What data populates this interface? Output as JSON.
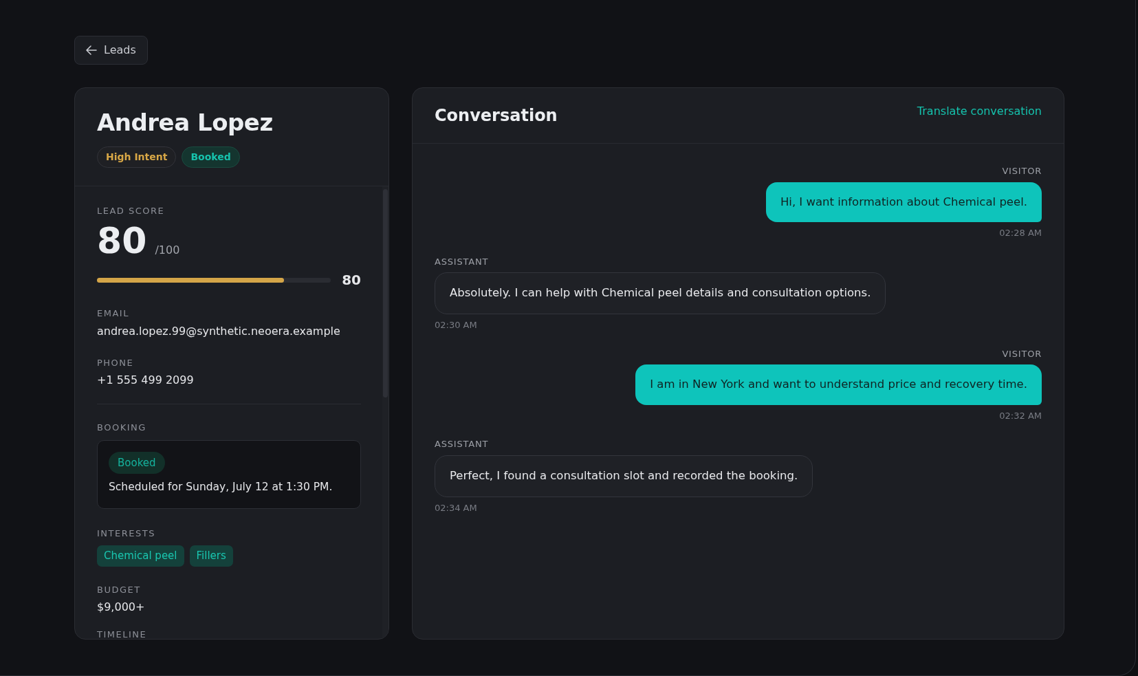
{
  "back_button": {
    "label": "Leads"
  },
  "lead": {
    "name": "Andrea Lopez",
    "badges": [
      {
        "label": "High Intent",
        "kind": "intent"
      },
      {
        "label": "Booked",
        "kind": "status"
      }
    ],
    "lead_score": {
      "label": "LEAD SCORE",
      "value": "80",
      "max": "/100",
      "level": 0.8,
      "reading": "80"
    },
    "fields": [
      {
        "label": "EMAIL",
        "value": "andrea.lopez.99@synthetic.neoera.example"
      },
      {
        "label": "PHONE",
        "value": "+1 555 499 2099"
      }
    ],
    "booking": {
      "label": "BOOKING",
      "status": "Booked",
      "text": "Scheduled for Sunday, July 12 at 1:30 PM."
    },
    "interests": {
      "label": "INTERESTS",
      "tags": [
        "Chemical peel",
        "Fillers"
      ]
    },
    "budget": {
      "label": "BUDGET",
      "value": "$9,000+"
    },
    "timeline": {
      "label": "TIMELINE"
    }
  },
  "conversation": {
    "title": "Conversation",
    "translate_link": "Translate conversation",
    "messages": [
      {
        "kind": "visitor",
        "sender": "VISITOR",
        "text": "Hi, I want information about Chemical peel.",
        "time": "02:28 AM"
      },
      {
        "kind": "assistant",
        "sender": "ASSISTANT",
        "text": "Absolutely. I can help with Chemical peel details and consultation options.",
        "time": "02:30 AM"
      },
      {
        "kind": "visitor",
        "sender": "VISITOR",
        "text": "I am in New York and want to understand price and recovery time.",
        "time": "02:32 AM"
      },
      {
        "kind": "assistant",
        "sender": "ASSISTANT",
        "text": "Perfect, I found a consultation slot and recorded the booking.",
        "time": "02:34 AM"
      }
    ]
  }
}
